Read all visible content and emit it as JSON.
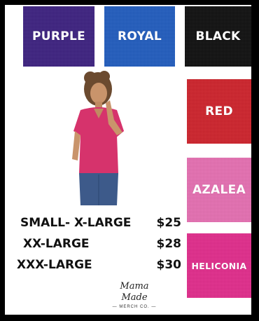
{
  "swatches": [
    {
      "label": "PURPLE",
      "color": "#3b1f80"
    },
    {
      "label": "ROYAL",
      "color": "#1f5cc0"
    },
    {
      "label": "BLACK",
      "color": "#0d0d0d"
    },
    {
      "label": "RED",
      "color": "#d0212a"
    },
    {
      "label": "AZALEA",
      "color": "#e86fb3"
    },
    {
      "label": "HELICONIA",
      "color": "#e42b8c"
    }
  ],
  "pricing": [
    {
      "size": "SMALL- X-LARGE",
      "price": "$25"
    },
    {
      "size": "XX-LARGE",
      "price": "$28"
    },
    {
      "size": "XXX-LARGE",
      "price": "$30"
    }
  ],
  "logo": {
    "script": "Mama Made",
    "sub": "— MERCH CO. —"
  },
  "model_shirt_color": "#d6336c"
}
